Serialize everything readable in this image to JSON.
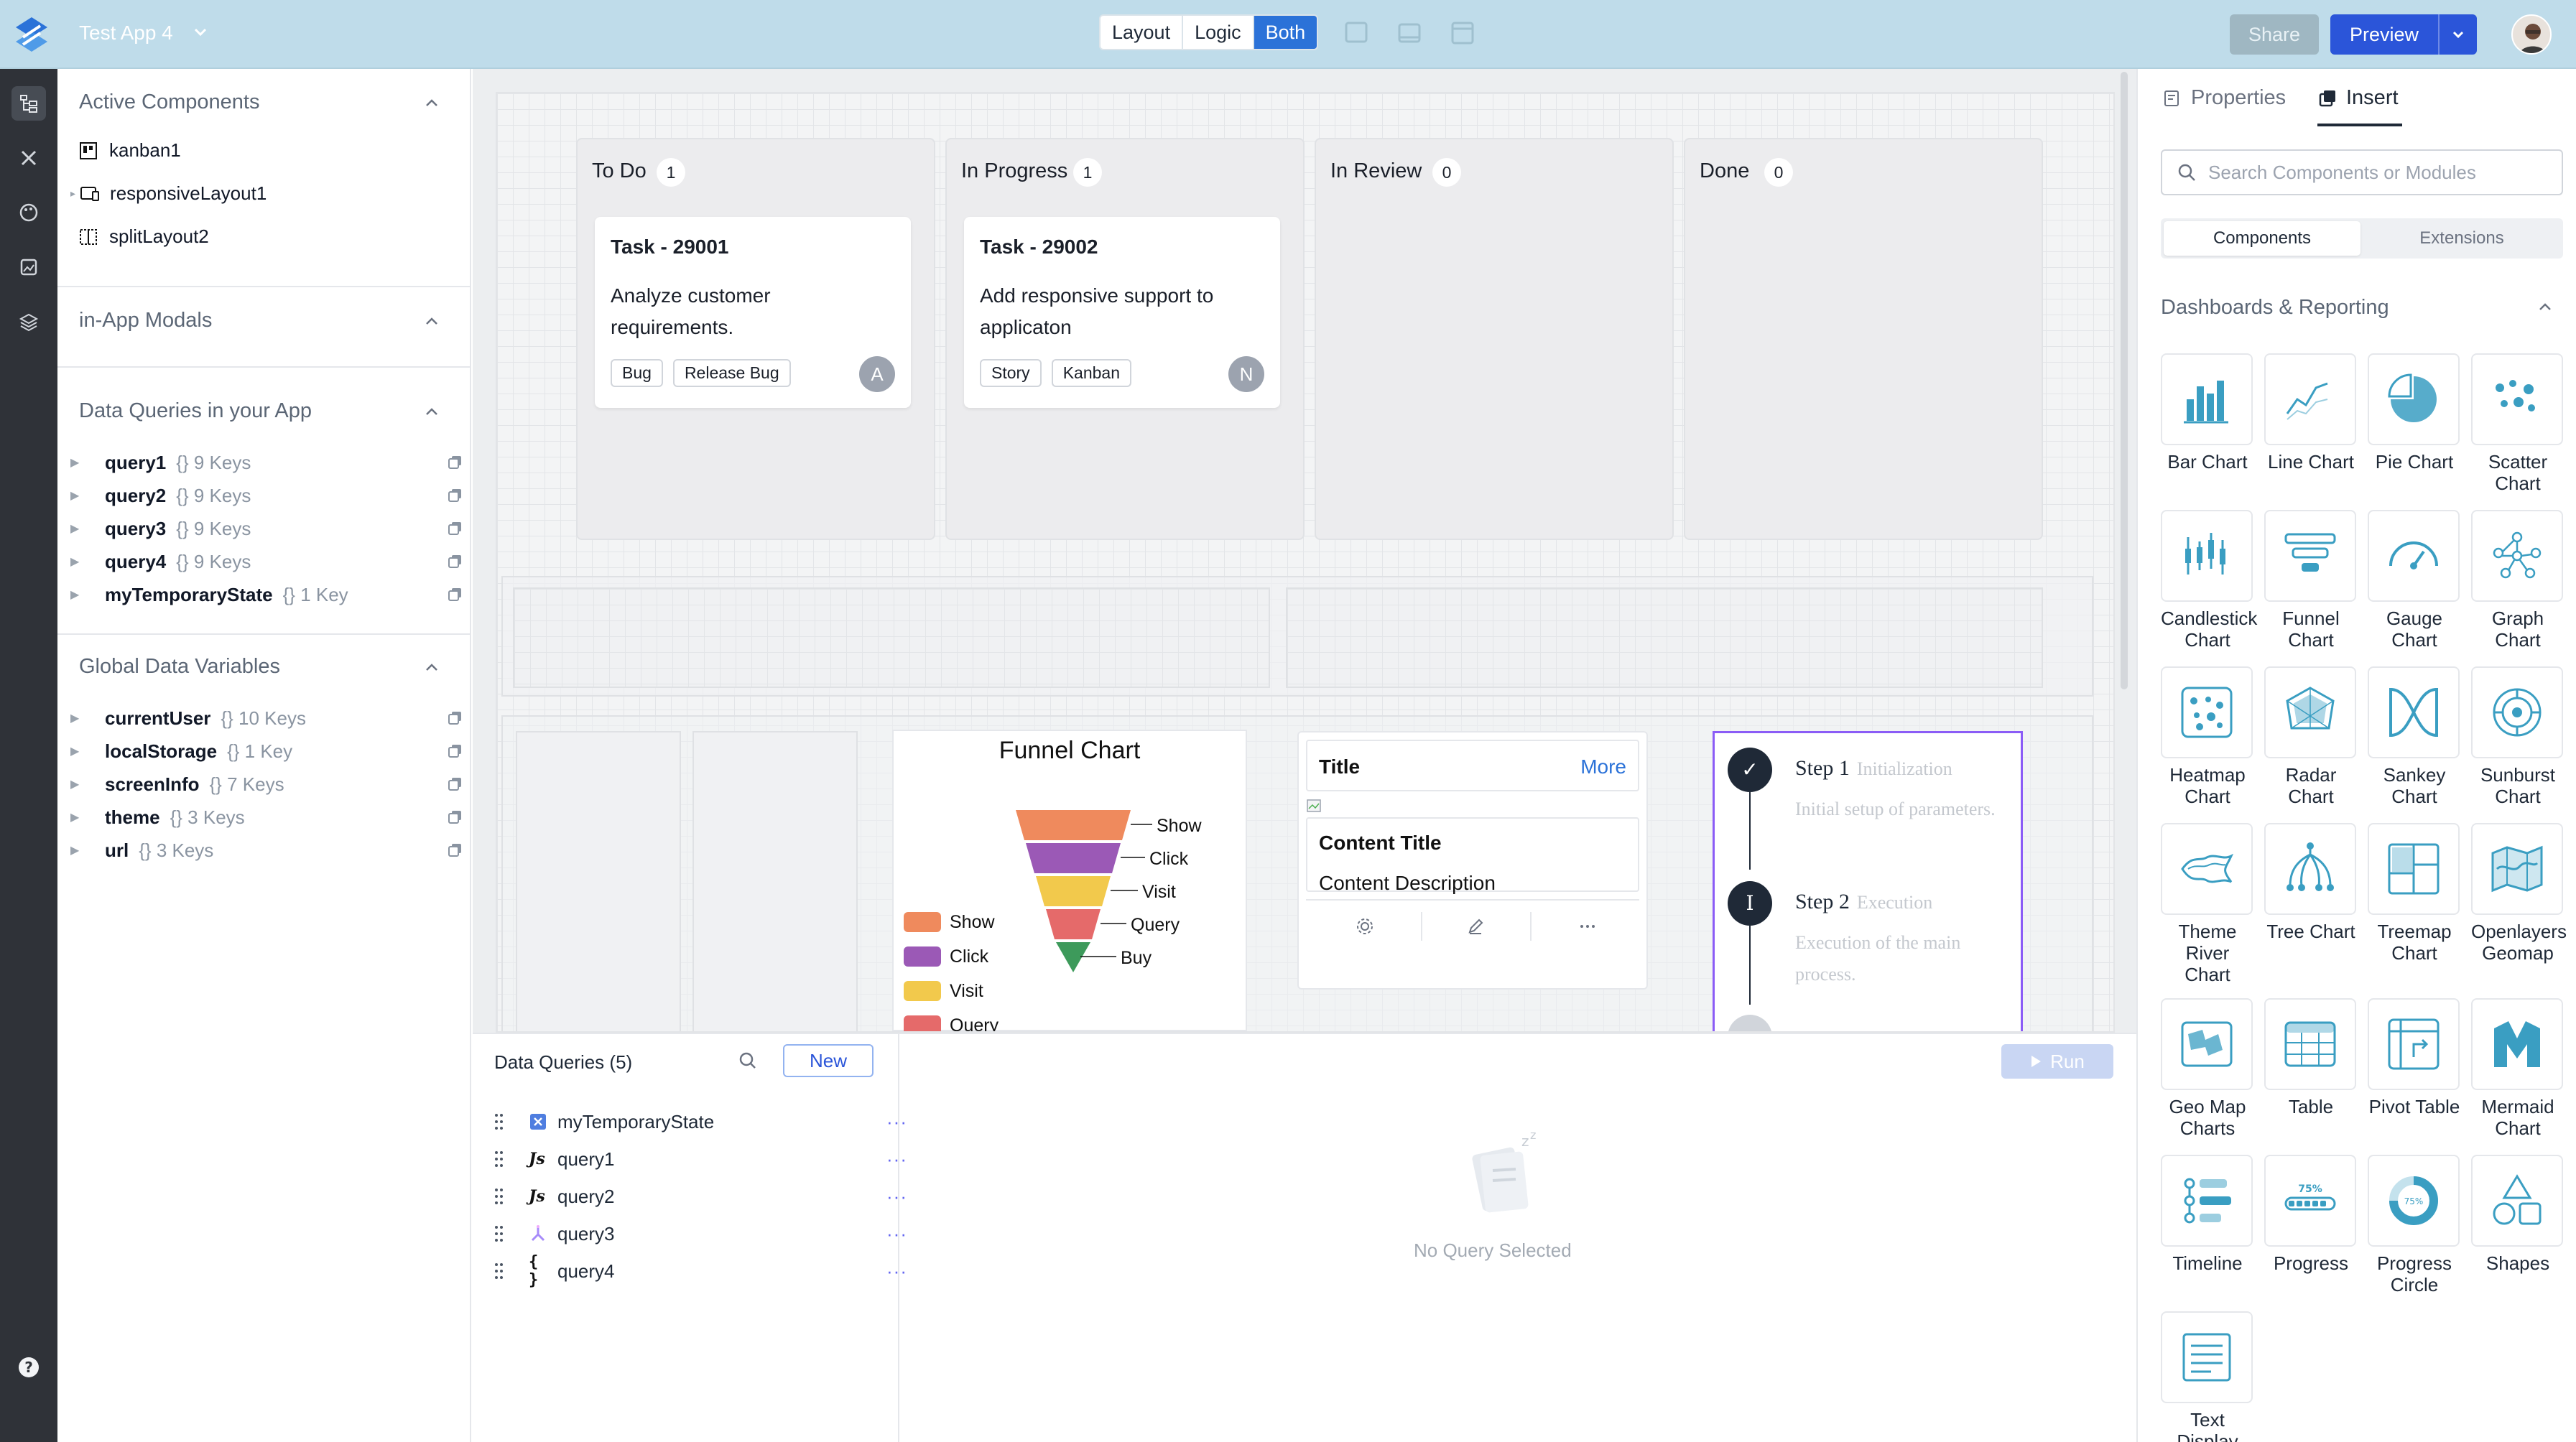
{
  "header": {
    "app_name": "Test App 4",
    "modes": [
      "Layout",
      "Logic",
      "Both"
    ],
    "active_mode": "Both",
    "share_label": "Share",
    "preview_label": "Preview"
  },
  "left_panel": {
    "active_components": {
      "title": "Active Components",
      "items": [
        "kanban1",
        "responsiveLayout1",
        "splitLayout2"
      ]
    },
    "modals": {
      "title": "in-App Modals"
    },
    "data_queries": {
      "title": "Data Queries in your App",
      "items": [
        {
          "name": "query1",
          "keys": "{} 9 Keys"
        },
        {
          "name": "query2",
          "keys": "{} 9 Keys"
        },
        {
          "name": "query3",
          "keys": "{} 9 Keys"
        },
        {
          "name": "query4",
          "keys": "{} 9 Keys"
        },
        {
          "name": "myTemporaryState",
          "keys": "{} 1 Key"
        }
      ]
    },
    "global_vars": {
      "title": "Global Data Variables",
      "items": [
        {
          "name": "currentUser",
          "keys": "{} 10 Keys"
        },
        {
          "name": "localStorage",
          "keys": "{} 1 Key"
        },
        {
          "name": "screenInfo",
          "keys": "{} 7 Keys"
        },
        {
          "name": "theme",
          "keys": "{} 3 Keys"
        },
        {
          "name": "url",
          "keys": "{} 3 Keys"
        }
      ]
    }
  },
  "kanban": {
    "columns": [
      {
        "title": "To Do",
        "count": "1",
        "card": {
          "title": "Task - 29001",
          "desc": "Analyze customer requirements.",
          "tags": [
            "Bug",
            "Release Bug"
          ],
          "avatar": "A"
        }
      },
      {
        "title": "In Progress",
        "count": "1",
        "card": {
          "title": "Task - 29002",
          "desc": "Add responsive support to applicaton",
          "tags": [
            "Story",
            "Kanban"
          ],
          "avatar": "N"
        }
      },
      {
        "title": "In Review",
        "count": "0"
      },
      {
        "title": "Done",
        "count": "0"
      }
    ]
  },
  "funnel": {
    "title": "Funnel Chart",
    "stages": [
      {
        "label": "Show",
        "color": "#ef8a5d"
      },
      {
        "label": "Click",
        "color": "#9b59b6"
      },
      {
        "label": "Visit",
        "color": "#f2c94c"
      },
      {
        "label": "Query",
        "color": "#e56a6a"
      },
      {
        "label": "Buy",
        "color": "#3d9a5b"
      }
    ],
    "legend": [
      "Show",
      "Click",
      "Visit",
      "Query"
    ]
  },
  "card_component": {
    "title": "Title",
    "more": "More",
    "content_title": "Content Title",
    "content_desc": "Content Description"
  },
  "steps": [
    {
      "num": "✓",
      "title": "Step 1",
      "sub": "Initialization",
      "desc": "Initial setup of parameters."
    },
    {
      "num": "I",
      "title": "Step 2",
      "sub": "Execution",
      "desc": "Execution of the main process."
    }
  ],
  "query_panel": {
    "title": "Data Queries (5)",
    "new_label": "New",
    "run_label": "Run",
    "empty_label": "No Query Selected",
    "queries": [
      {
        "name": "myTemporaryState",
        "icon": "temp-state-icon"
      },
      {
        "name": "query1",
        "icon": "js-icon"
      },
      {
        "name": "query2",
        "icon": "js-icon"
      },
      {
        "name": "query3",
        "icon": "connector-icon"
      },
      {
        "name": "query4",
        "icon": "json-icon"
      }
    ]
  },
  "right_panel": {
    "tabs": [
      "Properties",
      "Insert"
    ],
    "active_tab": "Insert",
    "search_placeholder": "Search Components or Modules",
    "segments": [
      "Components",
      "Extensions"
    ],
    "category": "Dashboards & Reporting",
    "widgets": [
      "Bar Chart",
      "Line Chart",
      "Pie Chart",
      "Scatter Chart",
      "Candlestick Chart",
      "Funnel Chart",
      "Gauge Chart",
      "Graph Chart",
      "Heatmap Chart",
      "Radar Chart",
      "Sankey Chart",
      "Sunburst Chart",
      "Theme River Chart",
      "Tree Chart",
      "Treemap Chart",
      "Openlayers Geomap",
      "Geo Map Charts",
      "Table",
      "Pivot Table",
      "Mermaid Chart",
      "Timeline",
      "Progress",
      "Progress Circle",
      "Shapes",
      "Text Display"
    ]
  },
  "colors": {
    "header_bg": "#bfdcea",
    "accent": "#2b55d9",
    "rail_bg": "#2f3238",
    "icon_teal": "#3a9ec2"
  }
}
